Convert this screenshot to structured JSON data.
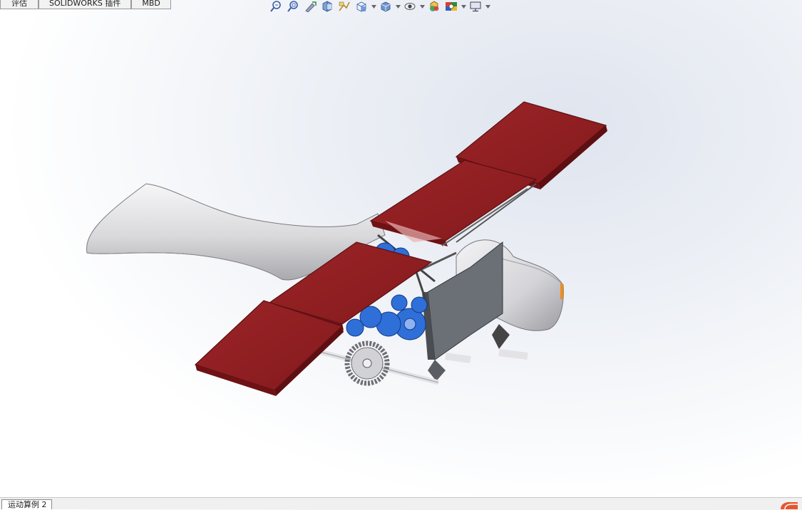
{
  "tabs": [
    {
      "label": "评估"
    },
    {
      "label": "SOLIDWORKS 插件"
    },
    {
      "label": "MBD"
    }
  ],
  "heads_up_toolbar": {
    "icons": [
      "zoom-to-fit-icon",
      "zoom-to-area-icon",
      "previous-view-icon",
      "section-view-icon",
      "dynamic-annotation-icon",
      "view-orientation-icon",
      "display-style-icon",
      "hide-show-items-icon",
      "edit-appearance-icon",
      "apply-scene-icon",
      "view-settings-icon"
    ]
  },
  "model": {
    "wing_color": "#8e1f22",
    "body_color": "#e6e6e8",
    "gear_color": "#2f6fd8",
    "frame_color": "#555a60"
  },
  "status_bar": {
    "motion_study_tab": "运动算例 2"
  }
}
